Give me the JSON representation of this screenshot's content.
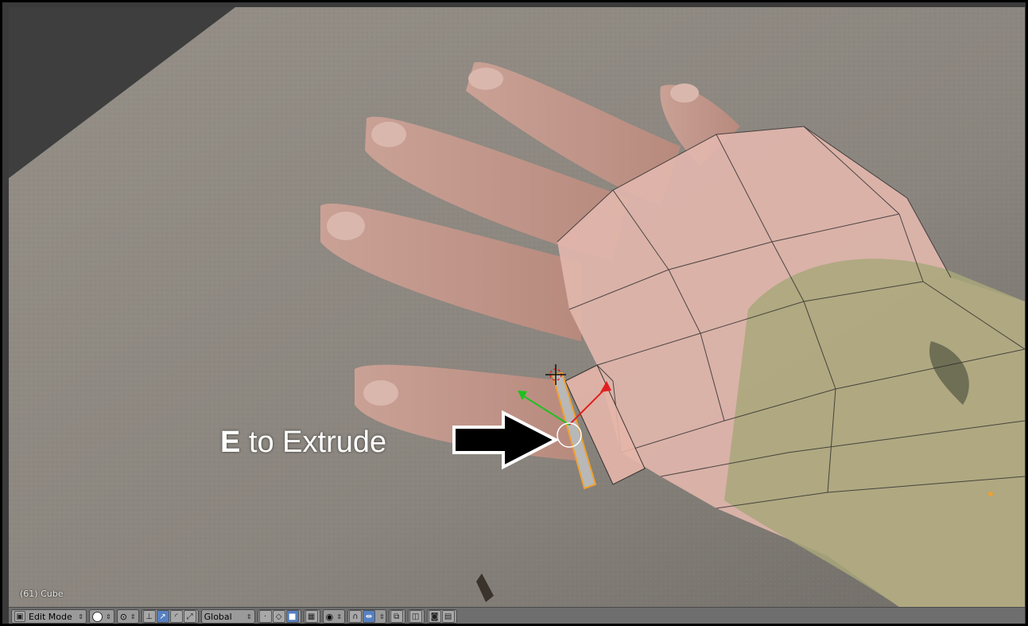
{
  "viewport": {
    "object_info": "(61) Cube",
    "annotation": {
      "key": "E",
      "text": " to Extrude"
    }
  },
  "header": {
    "mode": {
      "label": "Edit Mode",
      "icon": "object-mode-icon"
    },
    "shading": {
      "icon": "solid-sphere-icon"
    },
    "pivot": {
      "icon": "pivot-point-icon"
    },
    "manipulator_icons": [
      "manipulator-toggle-icon",
      "translate-icon",
      "rotate-icon",
      "scale-icon"
    ],
    "orientation": {
      "label": "Global"
    },
    "selection_mode_icons": [
      "vertex-select-icon",
      "edge-select-icon",
      "face-select-icon"
    ],
    "occlude_icon": "limit-selection-icon",
    "proportional_icon": "proportional-edit-icon",
    "snap_icons": [
      "snap-magnet-icon",
      "snap-target-icon"
    ],
    "other_icons": [
      "mirror-icon",
      "render-icon",
      "camera-icon",
      "clapboard-icon"
    ]
  },
  "colors": {
    "header_bg": "#6e6e6e",
    "selection_orange": "#f0a030",
    "x_axis": "#e02020",
    "y_axis": "#20c020"
  }
}
